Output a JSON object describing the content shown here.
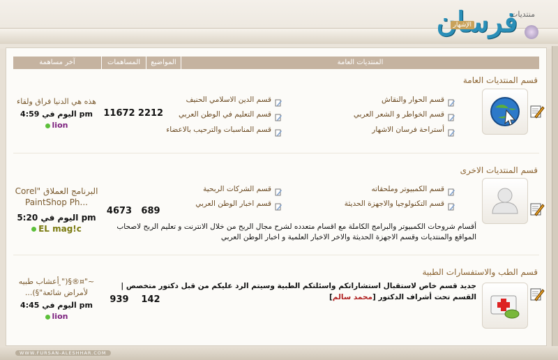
{
  "header": {
    "site_sub": "منتديات",
    "logo_text": "فرسان",
    "logo_badge": "الإشهار"
  },
  "table": {
    "columns": [
      "آخر مساهمة",
      "المساهمات",
      "المواضيع",
      "المنتديات العامة"
    ]
  },
  "categories": [
    {
      "title": "قسم المنتديات العامة",
      "forums_right": [
        "قسم الحوار والنقاش",
        "قسم الخواطر و الشعر العربي",
        "أستراحة فرسان الاشهار"
      ],
      "forums_left": [
        "قسم الدين الاسلامي الحنيف",
        "قسم التعليم في الوطن العربي",
        "قسم المناسبات والترحيب بالاعضاء"
      ],
      "topics": "2212",
      "posts": "11672",
      "last_post": {
        "title": "هذه هي الدنيا فراق ولقاء",
        "time": "اليوم في 4:59 pm",
        "user": "lion",
        "user_color": "#7b1f7d"
      }
    },
    {
      "title": "قسم المنتديات الاخرى",
      "forums_right": [
        "قسم الكمبيوتر وملحقاته",
        "قسم التكنولوجيا والاجهزة الحديثة"
      ],
      "forums_left": [
        "قسم الشركات الربحية",
        "قسم اخبار الوطن العربي"
      ],
      "description": "أقسام شروحات الكمبيوتر والبرامج الكاملة مع اقسام متعدده لشرح مجال الربح من خلال الانترنت و تعليم الربح لاصحاب المواقع والمنتديات وقسم الاجهزة الحديثة والاخر الاخبار العلمية و اخبار الوطن العربي",
      "topics": "689",
      "posts": "4673",
      "last_post": {
        "title_l1": "البرنامج العملاق \"Corel",
        "title_l2": "...PaintShop Ph",
        "time": "اليوم في 5:20 pm",
        "user": "EL mag!c",
        "user_color": "#7a7a10"
      }
    },
    {
      "title": "قسم الطب والاستفسارات الطبية",
      "description_l1": "جديد قسم خاص لاستقبال استشاراتكم واسئلتكم الطبية وسيتم الرد عليكم من قبل دكتور متخصص |",
      "description_l2_pre": "القسم تحت أشراف الدكتور",
      "moderator": "محمد سالم",
      "description_l2_post": "]",
      "description_l2_open": "[",
      "topics": "142",
      "posts": "939",
      "last_post": {
        "title_l1": "~\"¤®§(\"̯ أعشاب طبيه",
        "title_l2": "لأمراض شائعة\"§)...",
        "time": "اليوم في 4:45 pm",
        "user": "lion",
        "user_color": "#7b1f7d"
      }
    }
  ],
  "footer": {
    "text": "WWW.FURSAN-ALESHHAR.COM"
  },
  "colors": {
    "header_row": "#c5b3a0",
    "link": "#6b4a22",
    "category_title": "#8a6230"
  }
}
